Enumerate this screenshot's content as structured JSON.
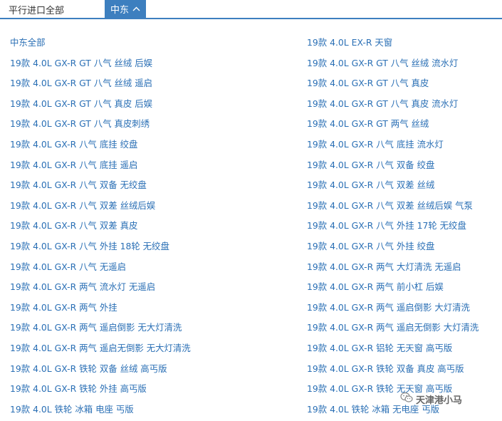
{
  "tabs": {
    "inactive_label": "平行进口全部",
    "active_label": "中东"
  },
  "models": {
    "col1": [
      "中东全部",
      "19款 4.0L GX-R GT 八气 丝绒 后娱",
      "19款 4.0L GX-R GT 八气 丝绒 遥启",
      "19款 4.0L GX-R GT 八气 真皮 后娱",
      "19款 4.0L GX-R GT 八气 真皮刺绣",
      "19款 4.0L GX-R 八气 底挂 绞盘",
      "19款 4.0L GX-R 八气 底挂 遥启",
      "19款 4.0L GX-R 八气 双备 无绞盘",
      "19款 4.0L GX-R 八气 双差 丝绒后娱",
      "19款 4.0L GX-R 八气 双差 真皮",
      "19款 4.0L GX-R 八气 外挂 18轮 无绞盘",
      "19款 4.0L GX-R 八气 无遥启",
      "19款 4.0L GX-R 两气 流水灯 无遥启",
      "19款 4.0L GX-R 两气 外挂",
      "19款 4.0L GX-R 两气 遥启倒影 无大灯清洗",
      "19款 4.0L GX-R 两气 遥启无倒影 无大灯清洗",
      "19款 4.0L GX-R 铁轮 双备 丝绒 高丐版",
      "19款 4.0L GX-R 铁轮 外挂 高丐版",
      "19款 4.0L 铁轮 冰箱 电座 丐版"
    ],
    "col2": [
      "19款 4.0L EX-R 天窗",
      "19款 4.0L GX-R GT 八气 丝绒 流水灯",
      "19款 4.0L GX-R GT 八气 真皮",
      "19款 4.0L GX-R GT 八气 真皮 流水灯",
      "19款 4.0L GX-R GT 两气 丝绒",
      "19款 4.0L GX-R 八气 底挂 流水灯",
      "19款 4.0L GX-R 八气 双备 绞盘",
      "19款 4.0L GX-R 八气 双差 丝绒",
      "19款 4.0L GX-R 八气 双差 丝绒后娱 气泵",
      "19款 4.0L GX-R 八气 外挂 17轮 无绞盘",
      "19款 4.0L GX-R 八气 外挂 绞盘",
      "19款 4.0L GX-R 两气 大灯清洗 无遥启",
      "19款 4.0L GX-R 两气 前小杠 后娱",
      "19款 4.0L GX-R 两气 遥启倒影 大灯清洗",
      "19款 4.0L GX-R 两气 遥启无倒影 大灯清洗",
      "19款 4.0L GX-R 铝轮 无天窗 高丐版",
      "19款 4.0L GX-R 铁轮 双备 真皮 高丐版",
      "19款 4.0L GX-R 铁轮 无天窗 高丐版",
      "19款 4.0L 铁轮 冰箱 无电座 丐版"
    ]
  },
  "watermark": {
    "text": "天津港小马",
    "icon": "wechat-icon"
  },
  "colors": {
    "accent": "#3d7fbf",
    "link": "#2a6fb5",
    "text": "#333333"
  }
}
